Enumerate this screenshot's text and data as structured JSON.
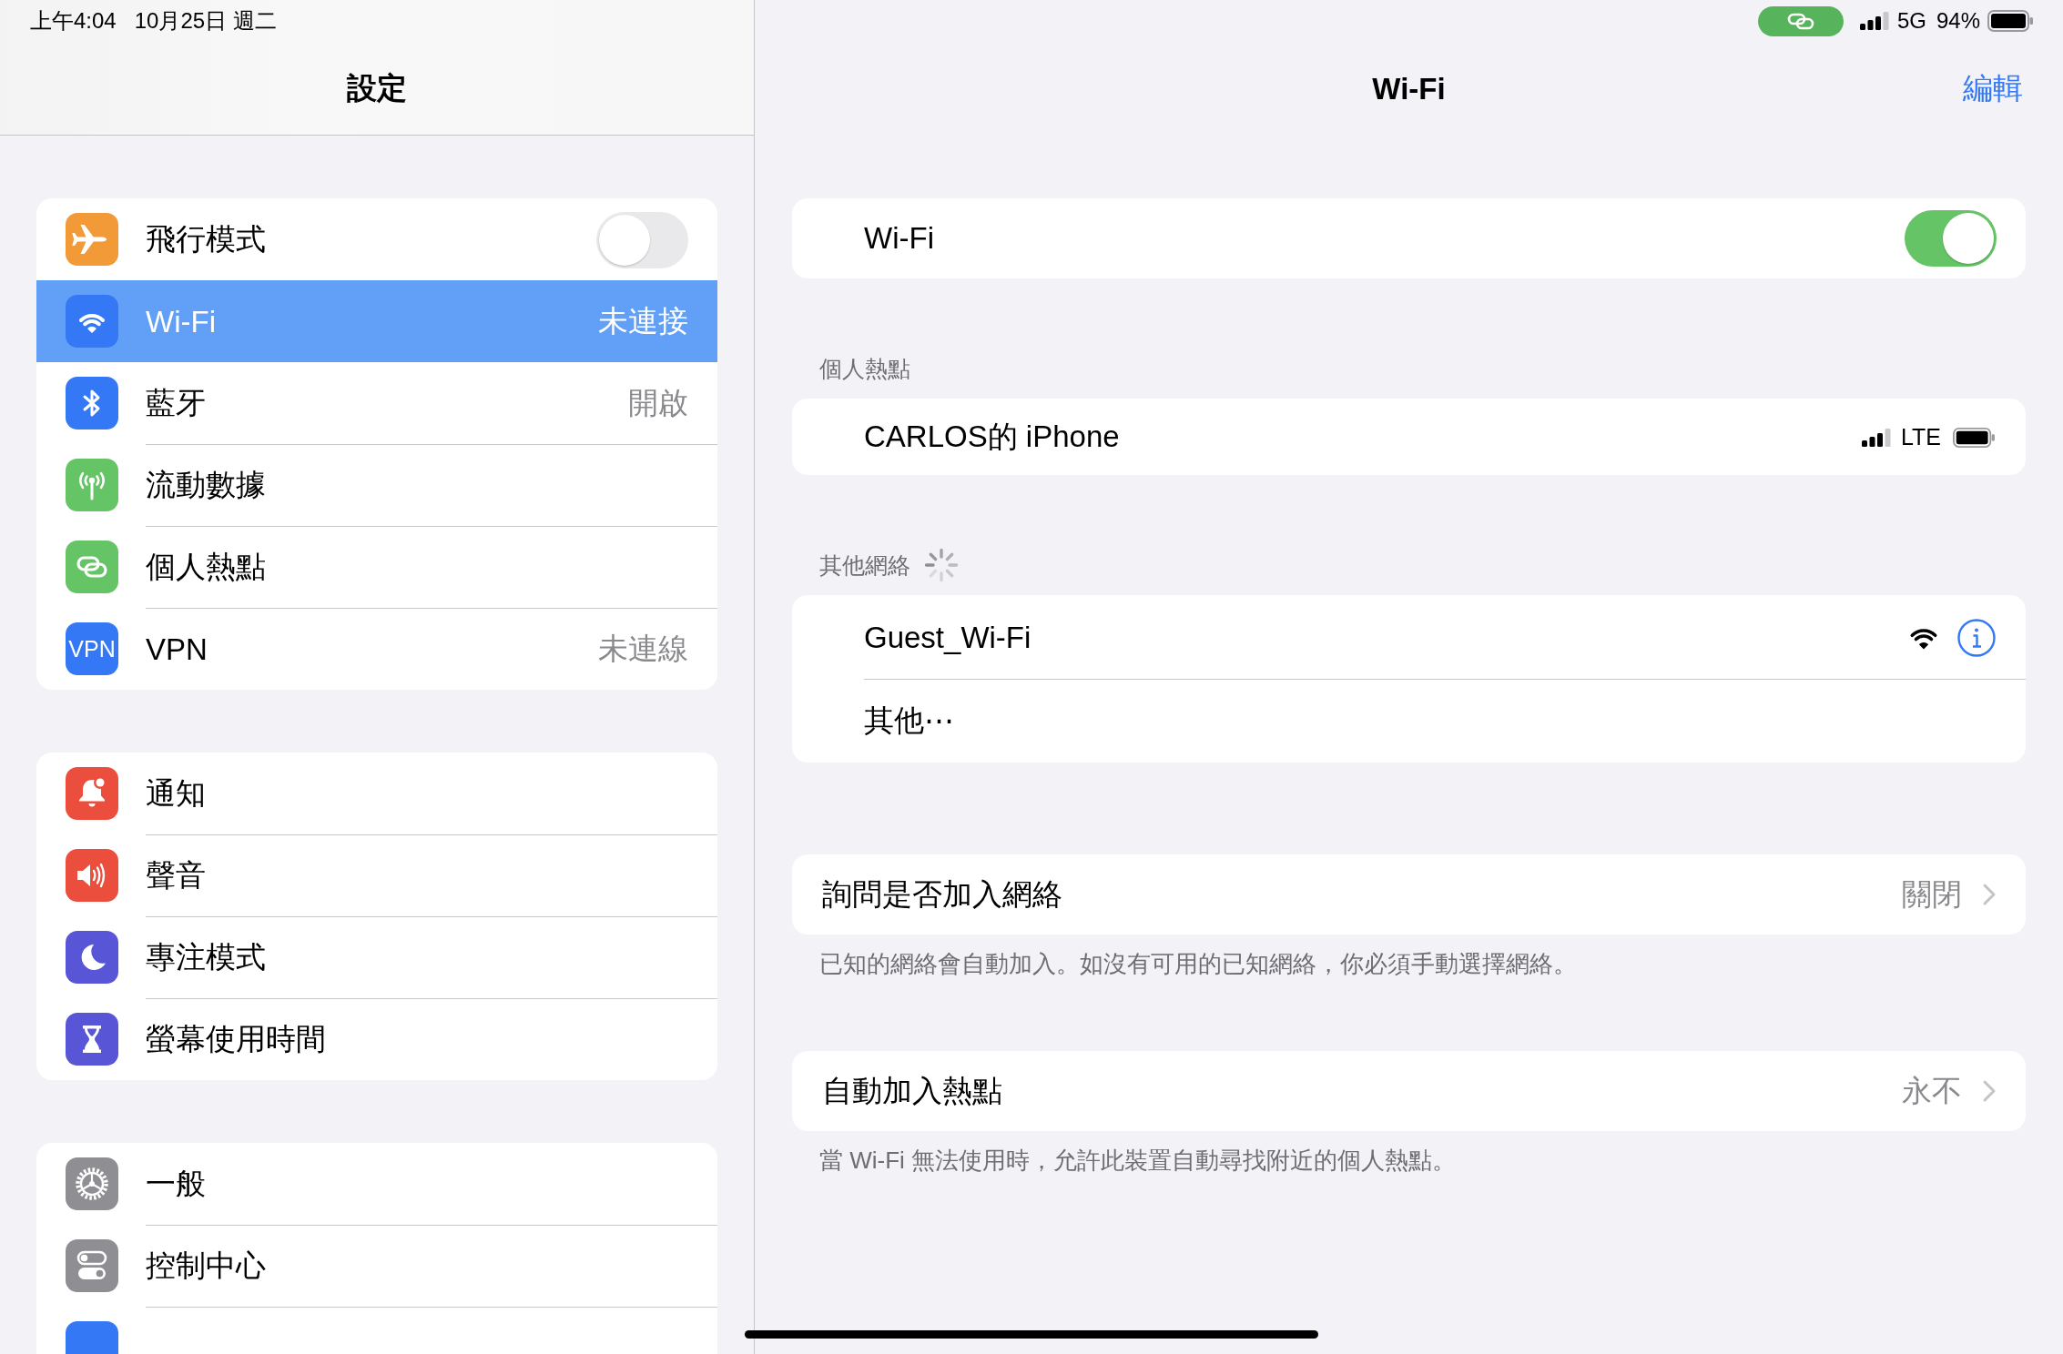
{
  "status_bar": {
    "time": "上午4:04",
    "date": "10月25日 週二",
    "network": "5G",
    "battery": "94%"
  },
  "sidebar": {
    "title": "設定",
    "groups": [
      {
        "items": [
          {
            "label": "飛行模式",
            "color": "#f19a37",
            "kind": "toggle",
            "on": false,
            "selected": false
          },
          {
            "label": "Wi-Fi",
            "color": "#3478f6",
            "kind": "link",
            "value": "未連接",
            "selected": true
          },
          {
            "label": "藍牙",
            "color": "#3478f6",
            "kind": "link",
            "value": "開啟",
            "selected": false
          },
          {
            "label": "流動數據",
            "color": "#65c466",
            "kind": "link",
            "selected": false
          },
          {
            "label": "個人熱點",
            "color": "#65c466",
            "kind": "link",
            "selected": false
          },
          {
            "label": "VPN",
            "color": "#3478f6",
            "kind": "link",
            "tile_text": "VPN",
            "value": "未連線",
            "selected": false
          }
        ]
      },
      {
        "items": [
          {
            "label": "通知",
            "color": "#eb4e3d",
            "kind": "link",
            "selected": false
          },
          {
            "label": "聲音",
            "color": "#eb4e3d",
            "kind": "link",
            "selected": false
          },
          {
            "label": "專注模式",
            "color": "#5856d6",
            "kind": "link",
            "selected": false
          },
          {
            "label": "螢幕使用時間",
            "color": "#5856d6",
            "kind": "link",
            "selected": false
          }
        ]
      },
      {
        "items": [
          {
            "label": "一般",
            "color": "#8e8e93",
            "kind": "link",
            "selected": false
          },
          {
            "label": "控制中心",
            "color": "#8e8e93",
            "kind": "link",
            "selected": false
          },
          {
            "color": "#3478f6",
            "kind": "link",
            "selected": false
          }
        ]
      }
    ]
  },
  "detail": {
    "title": "Wi-Fi",
    "edit": "編輯",
    "wifi_toggle": {
      "label": "Wi-Fi",
      "on": true
    },
    "sections": [
      {
        "header": "個人熱點",
        "loading": false,
        "rows": [
          {
            "kind": "hotspot",
            "name": "CARLOS的 iPhone",
            "cellular": "LTE"
          }
        ]
      },
      {
        "header": "其他網絡",
        "loading": true,
        "rows": [
          {
            "kind": "network",
            "name": "Guest_Wi-Fi"
          },
          {
            "kind": "other",
            "name": "其他⋯"
          }
        ]
      }
    ],
    "options": [
      {
        "label": "詢問是否加入網絡",
        "value": "關閉",
        "footer": "已知的網絡會自動加入。如沒有可用的已知網絡，你必須手動選擇網絡。"
      },
      {
        "label": "自動加入熱點",
        "value": "永不",
        "footer": "當 Wi-Fi 無法使用時，允許此裝置自動尋找附近的個人熱點。"
      }
    ]
  }
}
